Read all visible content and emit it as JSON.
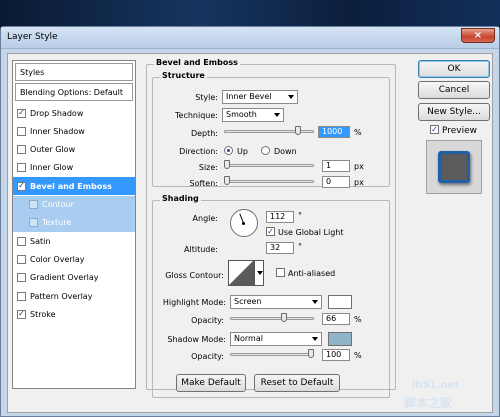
{
  "window": {
    "title": "Layer Style",
    "close_glyph": "×"
  },
  "left_panel": {
    "styles_label": "Styles",
    "blending_label": "Blending Options: Default",
    "items": [
      {
        "label": "Drop Shadow",
        "checked": true,
        "state": "normal"
      },
      {
        "label": "Inner Shadow",
        "checked": false,
        "state": "normal"
      },
      {
        "label": "Outer Glow",
        "checked": false,
        "state": "normal"
      },
      {
        "label": "Inner Glow",
        "checked": false,
        "state": "normal"
      },
      {
        "label": "Bevel and Emboss",
        "checked": true,
        "state": "selected"
      },
      {
        "label": "Contour",
        "checked": false,
        "state": "sub"
      },
      {
        "label": "Texture",
        "checked": false,
        "state": "sub"
      },
      {
        "label": "Satin",
        "checked": false,
        "state": "normal"
      },
      {
        "label": "Color Overlay",
        "checked": false,
        "state": "normal"
      },
      {
        "label": "Gradient Overlay",
        "checked": false,
        "state": "normal"
      },
      {
        "label": "Pattern Overlay",
        "checked": false,
        "state": "normal"
      },
      {
        "label": "Stroke",
        "checked": true,
        "state": "normal"
      }
    ]
  },
  "bevel": {
    "group_title": "Bevel and Emboss",
    "structure_title": "Structure",
    "style_label": "Style:",
    "style_value": "Inner Bevel",
    "technique_label": "Technique:",
    "technique_value": "Smooth",
    "depth_label": "Depth:",
    "depth_value": "1000",
    "depth_unit": "%",
    "depth_level": 0.85,
    "direction_label": "Direction:",
    "dir_up": "Up",
    "dir_down": "Down",
    "direction_selected": "Up",
    "size_label": "Size:",
    "size_value": "1",
    "size_unit": "px",
    "size_level": 0.0,
    "soften_label": "Soften:",
    "soften_value": "0",
    "soften_unit": "px",
    "soften_level": 0.0
  },
  "shading": {
    "title": "Shading",
    "angle_label": "Angle:",
    "angle_value": "112",
    "angle_unit": "°",
    "global_light_label": "Use Global Light",
    "global_light_checked": true,
    "altitude_label": "Altitude:",
    "altitude_value": "32",
    "altitude_unit": "°",
    "gloss_label": "Gloss Contour:",
    "anti_aliased_label": "Anti-aliased",
    "anti_aliased_checked": false,
    "highlight_mode_label": "Highlight Mode:",
    "highlight_mode_value": "Screen",
    "highlight_color": "#ffffff",
    "opacity_label": "Opacity:",
    "highlight_opacity_value": "66",
    "highlight_opacity_unit": "%",
    "highlight_opacity_level": 0.66,
    "shadow_mode_label": "Shadow Mode:",
    "shadow_mode_value": "Normal",
    "shadow_color": "#8fb4c8",
    "shadow_opacity_value": "100",
    "shadow_opacity_unit": "%",
    "shadow_opacity_level": 1.0
  },
  "footer": {
    "make_default": "Make Default",
    "reset_default": "Reset to Default"
  },
  "right": {
    "ok": "OK",
    "cancel": "Cancel",
    "new_style": "New Style...",
    "preview_label": "Preview",
    "preview_checked": true,
    "preview_fill": "#5b5b5b",
    "preview_border": "#1f5fa8"
  },
  "watermark": {
    "line1": "jb51.net",
    "line2": "脚本之家"
  }
}
